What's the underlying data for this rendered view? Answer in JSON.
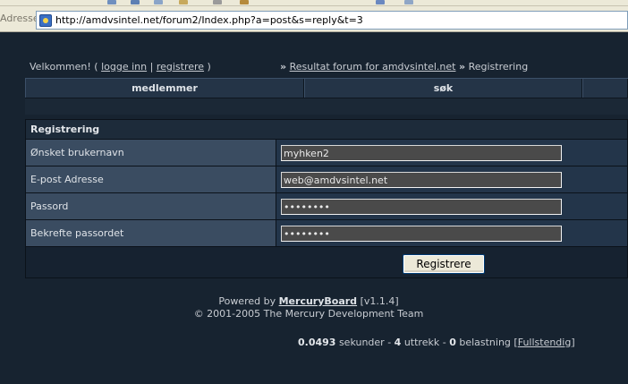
{
  "browser": {
    "address_label": "Adresse",
    "url": "http://amdvsintel.net/forum2/Index.php?a=post&s=reply&t=3"
  },
  "topline": {
    "welcome_prefix": "Velkommen! (",
    "login_link": "logge inn",
    "separator": "|",
    "register_link": "registrere",
    "welcome_suffix": ")",
    "crumb_arrow_1": "»",
    "crumb_forum_link": "Resultat forum for amdvsintel.net",
    "crumb_arrow_2": "»",
    "crumb_current": "Registrering"
  },
  "navbar": {
    "items": [
      {
        "label": "medlemmer"
      },
      {
        "label": "søk"
      },
      {
        "label": ""
      }
    ]
  },
  "form": {
    "title": "Registrering",
    "fields": [
      {
        "label": "Ønsket brukernavn",
        "value": "myhken2",
        "type": "text"
      },
      {
        "label": "E-post Adresse",
        "value": "web@amdvsintel.net",
        "type": "text"
      },
      {
        "label": "Passord",
        "value": "passord1",
        "type": "password"
      },
      {
        "label": "Bekrefte passordet",
        "value": "passord1",
        "type": "password"
      }
    ],
    "submit_label": "Registrere"
  },
  "footer": {
    "powered_by": "Powered by",
    "product_link": "MercuryBoard",
    "version": "[v1.1.4]",
    "copyright": "© 2001-2005 The Mercury Development Team",
    "stats_time": "0.0493",
    "stats_time_unit": "sekunder -",
    "stats_queries": "4",
    "stats_queries_unit": "uttrekk -",
    "stats_load": "0",
    "stats_load_unit": "belastning",
    "full_link": "Fullstendig"
  },
  "colors": {
    "page_bg": "#172330",
    "label_bg": "#3a4c61",
    "field_bg": "#23354a",
    "input_bg": "#4a4a4a"
  }
}
